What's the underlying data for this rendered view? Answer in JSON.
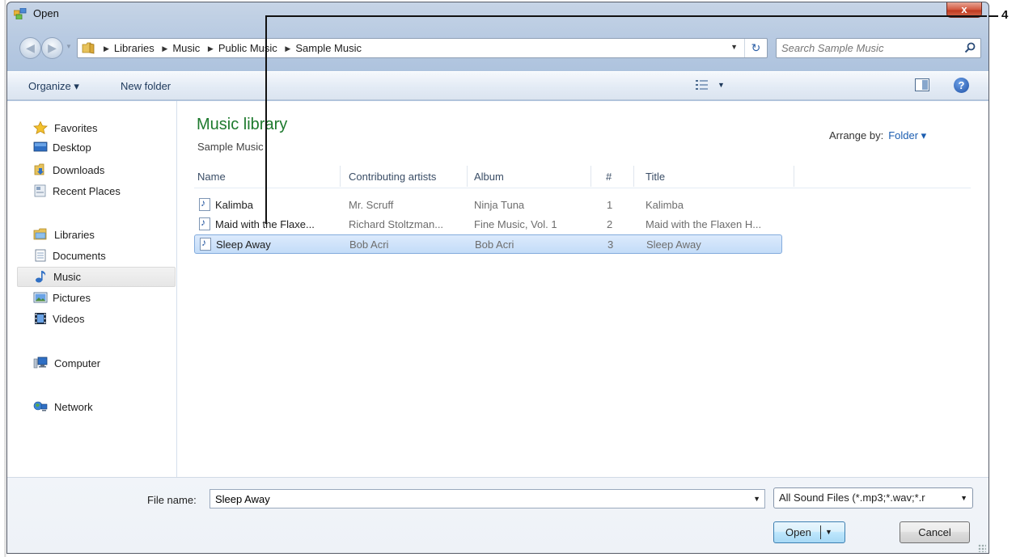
{
  "window": {
    "title": "Open",
    "close_label": "x"
  },
  "nav": {
    "breadcrumbs": [
      "Libraries",
      "Music",
      "Public Music",
      "Sample Music"
    ],
    "search_placeholder": "Search Sample Music"
  },
  "toolbar": {
    "organize_label": "Organize ▾",
    "new_folder_label": "New folder",
    "help_label": "?"
  },
  "sidebar": {
    "favorites": {
      "label": "Favorites",
      "icon": "star-icon"
    },
    "favorite_items": [
      {
        "label": "Desktop",
        "icon": "desktop-icon"
      },
      {
        "label": "Downloads",
        "icon": "downloads-icon"
      },
      {
        "label": "Recent Places",
        "icon": "recent-places-icon"
      }
    ],
    "libraries": {
      "label": "Libraries",
      "icon": "libraries-icon"
    },
    "library_items": [
      {
        "label": "Documents",
        "icon": "documents-icon"
      },
      {
        "label": "Music",
        "icon": "music-icon",
        "selected": true
      },
      {
        "label": "Pictures",
        "icon": "pictures-icon"
      },
      {
        "label": "Videos",
        "icon": "videos-icon"
      }
    ],
    "computer": {
      "label": "Computer",
      "icon": "computer-icon"
    },
    "network": {
      "label": "Network",
      "icon": "network-icon"
    }
  },
  "main": {
    "library_title": "Music library",
    "library_subtitle": "Sample Music",
    "arrange_label": "Arrange by:",
    "arrange_value": "Folder ▾",
    "columns": [
      "Name",
      "Contributing artists",
      "Album",
      "#",
      "Title"
    ],
    "files": [
      {
        "name": "Kalimba",
        "artist": "Mr. Scruff",
        "album": "Ninja Tuna",
        "track": "1",
        "title": "Kalimba"
      },
      {
        "name": "Maid with the Flaxe...",
        "artist": "Richard Stoltzman...",
        "album": "Fine Music, Vol. 1",
        "track": "2",
        "title": "Maid with the Flaxen H..."
      },
      {
        "name": "Sleep Away",
        "artist": "Bob Acri",
        "album": "Bob Acri",
        "track": "3",
        "title": "Sleep Away",
        "selected": true
      }
    ]
  },
  "bottom": {
    "file_name_label": "File name:",
    "file_name_value": "Sleep Away",
    "filter_value": "All Sound Files (*.mp3;*.wav;*.r",
    "open_label": "Open",
    "cancel_label": "Cancel"
  },
  "callout": {
    "number": "4"
  },
  "colors": {
    "library_title": "#1e7a2e",
    "link_blue": "#1b5db0",
    "selection": "#c3dcf8",
    "close_red": "#c0391f"
  }
}
